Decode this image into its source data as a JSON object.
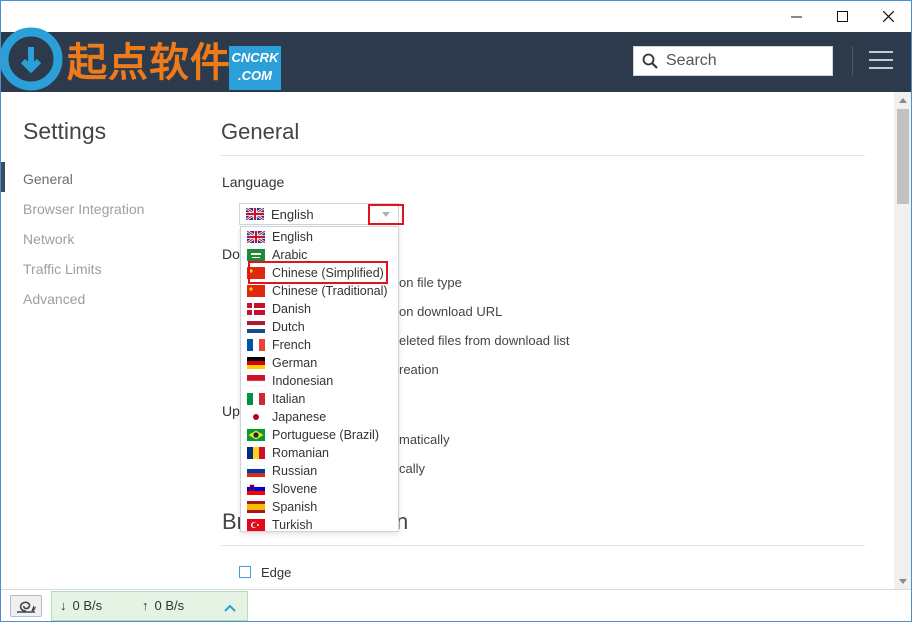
{
  "logo": {
    "text": "起点软件",
    "badge_line1": "CNCRK",
    "badge_line2": ".COM"
  },
  "header": {
    "search_placeholder": "Search"
  },
  "sidebar": {
    "title": "Settings",
    "items": [
      {
        "label": "General"
      },
      {
        "label": "Browser Integration"
      },
      {
        "label": "Network"
      },
      {
        "label": "Traffic Limits"
      },
      {
        "label": "Advanced"
      }
    ]
  },
  "main": {
    "general_title": "General",
    "language_label": "Language",
    "selected_language": "English",
    "downloads_label_fragment": "Do",
    "options": [
      "on file type",
      "on download URL",
      "eleted files from download list",
      "reation"
    ],
    "updates_label_fragment": "Up",
    "update_options": [
      "matically",
      "cally"
    ],
    "browser_section_fragment_left": "Br",
    "browser_section_fragment_right": "n",
    "edge_label": "Edge"
  },
  "dropdown": {
    "languages": [
      {
        "name": "English",
        "flag": "uk"
      },
      {
        "name": "Arabic",
        "flag": "sa"
      },
      {
        "name": "Chinese (Simplified)",
        "flag": "cn"
      },
      {
        "name": "Chinese (Traditional)",
        "flag": "cn"
      },
      {
        "name": "Danish",
        "flag": "dk"
      },
      {
        "name": "Dutch",
        "flag": "nl"
      },
      {
        "name": "French",
        "flag": "fr"
      },
      {
        "name": "German",
        "flag": "de"
      },
      {
        "name": "Indonesian",
        "flag": "id"
      },
      {
        "name": "Italian",
        "flag": "it"
      },
      {
        "name": "Japanese",
        "flag": "jp"
      },
      {
        "name": "Portuguese (Brazil)",
        "flag": "br"
      },
      {
        "name": "Romanian",
        "flag": "ro"
      },
      {
        "name": "Russian",
        "flag": "ru"
      },
      {
        "name": "Slovene",
        "flag": "si"
      },
      {
        "name": "Spanish",
        "flag": "es"
      },
      {
        "name": "Turkish",
        "flag": "tr"
      }
    ],
    "highlighted": "Chinese (Simplified)"
  },
  "status": {
    "download_speed": "0 B/s",
    "upload_speed": "0 B/s"
  },
  "colors": {
    "header_bg": "#2d3a4b",
    "accent_red": "#e0141e",
    "logo_orange": "#ef7a1a",
    "logo_blue": "#2a9fd8",
    "speed_bg": "#e5f3e4"
  }
}
